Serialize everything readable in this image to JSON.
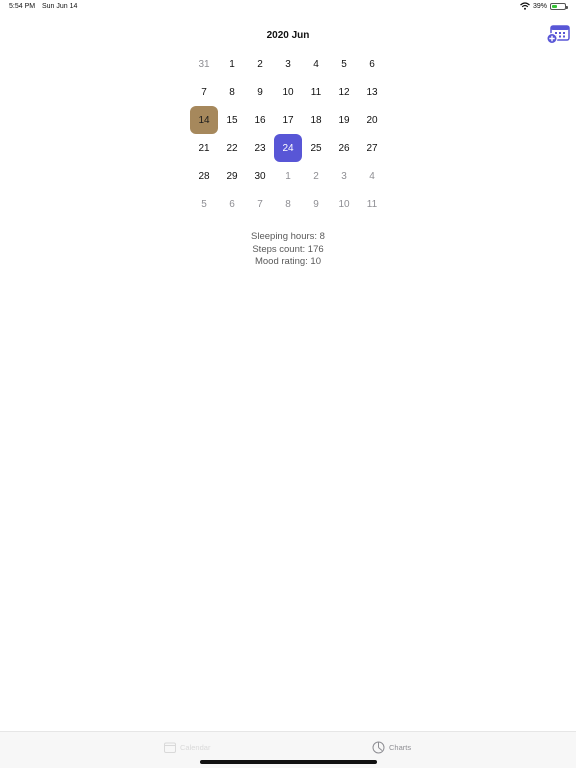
{
  "status_bar": {
    "time": "5:54 PM",
    "date": "Sun Jun 14",
    "battery": "39%",
    "battery_level": 0.39,
    "icons": [
      "wifi-icon",
      "battery-icon"
    ]
  },
  "header": {
    "title": "2020 Jun",
    "add_event_icon": "calendar-add-icon",
    "accent_color": "#5856d6"
  },
  "calendar": {
    "weeks": [
      [
        {
          "d": "31",
          "m": true
        },
        {
          "d": "1"
        },
        {
          "d": "2"
        },
        {
          "d": "3"
        },
        {
          "d": "4"
        },
        {
          "d": "5"
        },
        {
          "d": "6"
        }
      ],
      [
        {
          "d": "7"
        },
        {
          "d": "8"
        },
        {
          "d": "9"
        },
        {
          "d": "10"
        },
        {
          "d": "11"
        },
        {
          "d": "12"
        },
        {
          "d": "13"
        }
      ],
      [
        {
          "d": "14",
          "today": true
        },
        {
          "d": "15"
        },
        {
          "d": "16"
        },
        {
          "d": "17"
        },
        {
          "d": "18"
        },
        {
          "d": "19"
        },
        {
          "d": "20"
        }
      ],
      [
        {
          "d": "21"
        },
        {
          "d": "22"
        },
        {
          "d": "23"
        },
        {
          "d": "24",
          "selected": true
        },
        {
          "d": "25"
        },
        {
          "d": "26"
        },
        {
          "d": "27"
        }
      ],
      [
        {
          "d": "28"
        },
        {
          "d": "29"
        },
        {
          "d": "30"
        },
        {
          "d": "1",
          "m": true
        },
        {
          "d": "2",
          "m": true
        },
        {
          "d": "3",
          "m": true
        },
        {
          "d": "4",
          "m": true
        }
      ],
      [
        {
          "d": "5",
          "m": true
        },
        {
          "d": "6",
          "m": true
        },
        {
          "d": "7",
          "m": true
        },
        {
          "d": "8",
          "m": true
        },
        {
          "d": "9",
          "m": true
        },
        {
          "d": "10",
          "m": true
        },
        {
          "d": "11",
          "m": true
        }
      ]
    ],
    "today_color": "#a6885c",
    "selected_color": "#5856d6"
  },
  "stats": {
    "sleeping": "Sleeping hours: 8",
    "steps": "Steps count: 176",
    "mood": "Mood rating: 10"
  },
  "tab_bar": {
    "calendar_label": "Calendar",
    "calendar_icon": "calendar-icon",
    "charts_label": "Charts",
    "charts_icon": "chart-icon"
  }
}
